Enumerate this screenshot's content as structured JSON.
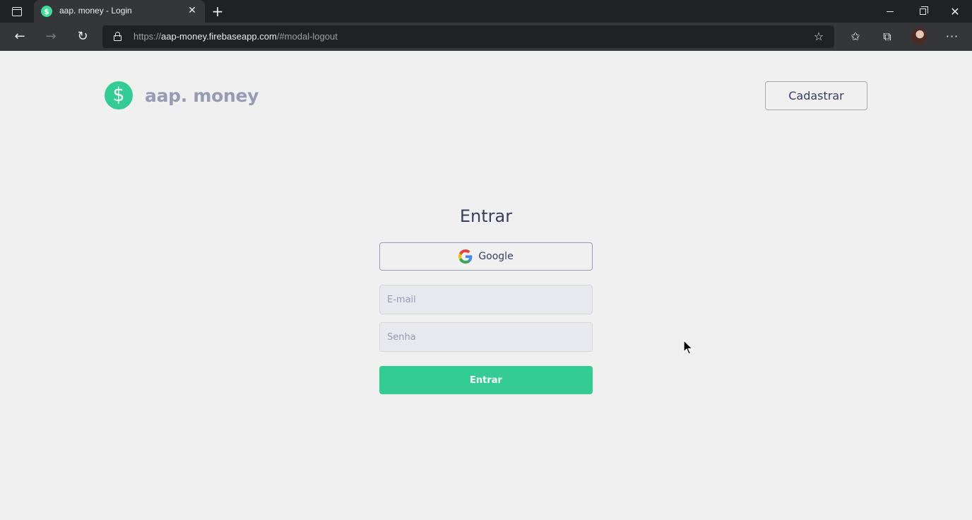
{
  "browser": {
    "tab_title": "aap. money - Login",
    "tab_favicon": "$",
    "url_prefix": "https://",
    "url_host": "aap-money.firebaseapp.com",
    "url_path": "/#modal-logout",
    "icons": {
      "tab_actions": "tab-actions-icon",
      "close": "close-icon",
      "new_tab": "plus-icon",
      "back": "arrow-left-icon",
      "forward": "arrow-right-icon",
      "reload": "reload-icon",
      "lock": "lock-icon",
      "add_favorite": "star-add-icon",
      "favorites": "favorites-icon",
      "collections": "collections-icon",
      "profile": "avatar",
      "more": "more-icon"
    }
  },
  "header": {
    "logo_symbol": "$",
    "logo_text": "aap. money",
    "signup_label": "Cadastrar"
  },
  "login": {
    "title": "Entrar",
    "google_label": "Google",
    "email_placeholder": "E-mail",
    "password_placeholder": "Senha",
    "submit_label": "Entrar"
  },
  "colors": {
    "accent": "#33cc95",
    "text_title": "#363f5f",
    "text_body": "#969cb3",
    "background": "#f0f0f0",
    "input_background": "#e7e9ee"
  }
}
